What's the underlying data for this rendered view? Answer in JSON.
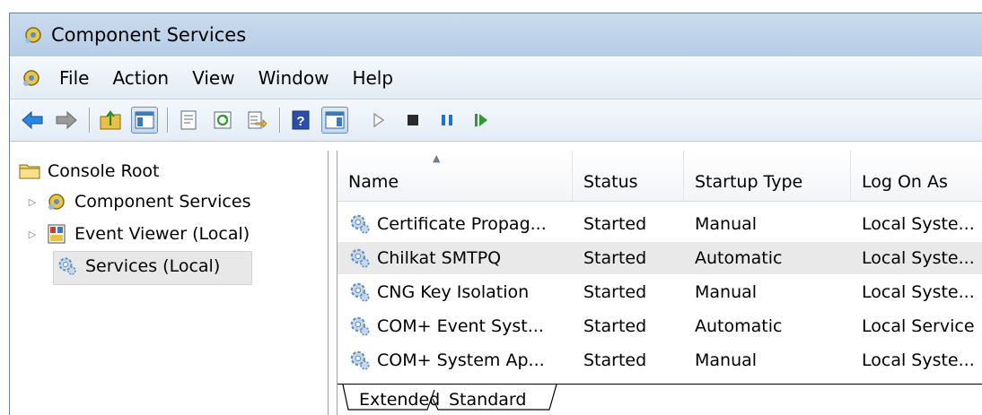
{
  "window": {
    "title": "Component Services"
  },
  "menu": {
    "items": [
      "File",
      "Action",
      "View",
      "Window",
      "Help"
    ]
  },
  "toolbar": {
    "buttons": [
      "back-arrow-icon",
      "forward-arrow-icon",
      "up-folder-icon",
      "show-hide-console-tree-icon",
      "properties-icon",
      "refresh-icon",
      "export-list-icon",
      "help-icon",
      "show-hide-action-pane-icon",
      "start-service-icon",
      "stop-service-icon",
      "pause-service-icon",
      "resume-service-icon"
    ]
  },
  "tree": {
    "root": "Console Root",
    "items": [
      {
        "label": "Component Services",
        "icon": "component-services-icon",
        "expandable": true
      },
      {
        "label": "Event Viewer (Local)",
        "icon": "event-viewer-icon",
        "expandable": true
      },
      {
        "label": "Services (Local)",
        "icon": "services-icon",
        "expandable": false,
        "selected": true
      }
    ]
  },
  "list": {
    "columns": [
      "Name",
      "Status",
      "Startup Type",
      "Log On As"
    ],
    "sorted_column": "Name",
    "rows": [
      {
        "name": "Certificate Propag...",
        "status": "Started",
        "startup": "Manual",
        "logon": "Local Syste..."
      },
      {
        "name": "Chilkat SMTPQ",
        "status": "Started",
        "startup": "Automatic",
        "logon": "Local Syste...",
        "selected": true
      },
      {
        "name": "CNG Key Isolation",
        "status": "Started",
        "startup": "Manual",
        "logon": "Local Syste..."
      },
      {
        "name": "COM+ Event Syst...",
        "status": "Started",
        "startup": "Automatic",
        "logon": "Local Service"
      },
      {
        "name": "COM+ System Ap...",
        "status": "Started",
        "startup": "Manual",
        "logon": "Local Syste..."
      }
    ]
  },
  "tabs": {
    "extended": "Extended",
    "standard": "Standard",
    "active": "Standard"
  },
  "colors": {
    "titlebar": "#c0d4eb",
    "toolbar_blue": "#1e73d2",
    "gear_blue": "#5a8fc8"
  }
}
